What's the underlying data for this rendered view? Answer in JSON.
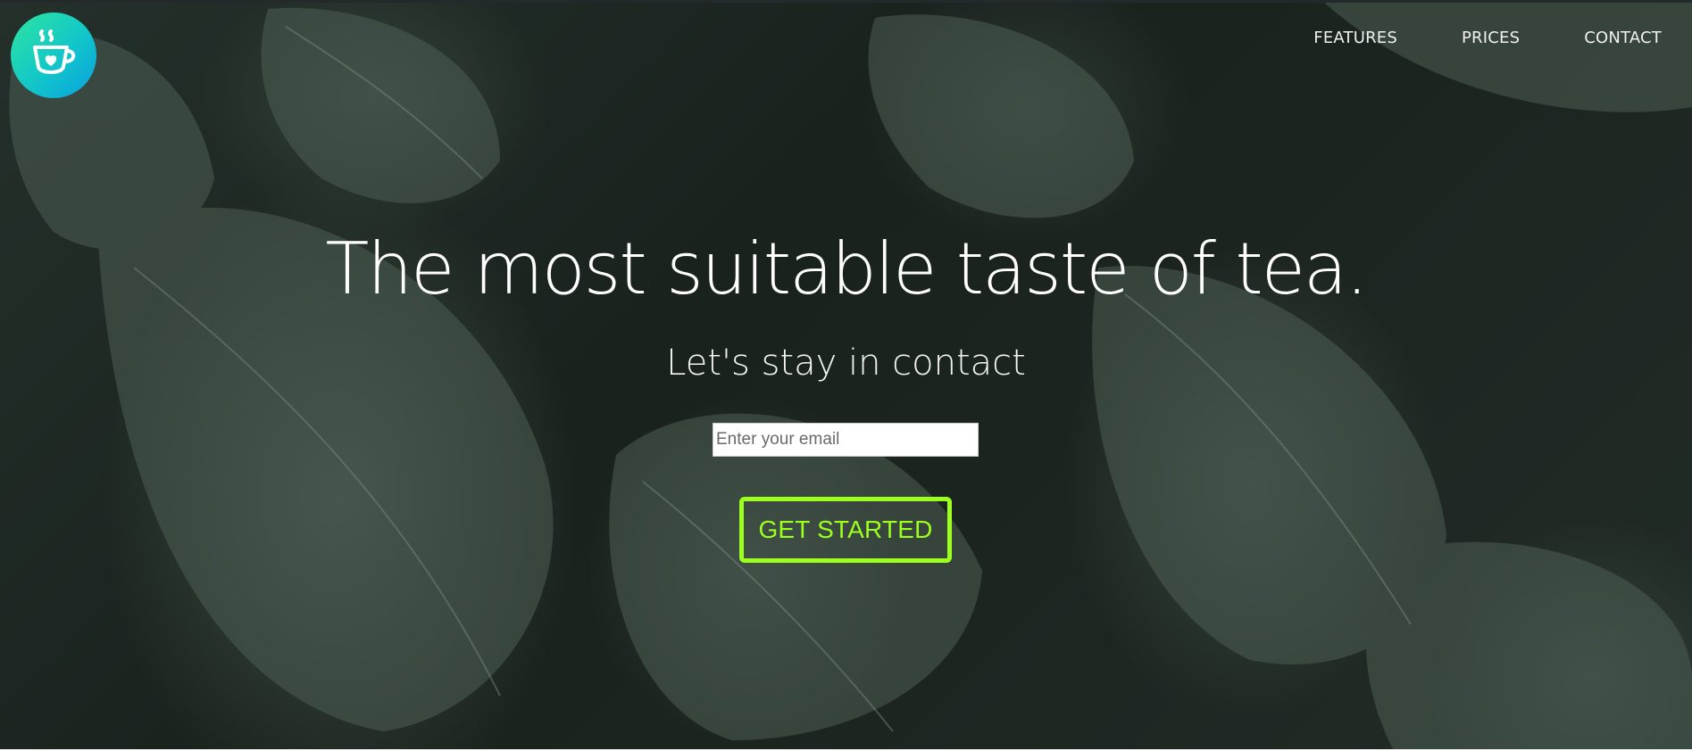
{
  "header": {
    "logo_icon": "tea-cup-heart-icon",
    "nav": [
      {
        "label": "FEATURES"
      },
      {
        "label": "PRICES"
      },
      {
        "label": "CONTACT"
      }
    ]
  },
  "hero": {
    "headline": "The most suitable taste of tea.",
    "subhead": "Let's stay in contact",
    "email": {
      "placeholder": "Enter your email",
      "value": ""
    },
    "cta_label": "GET STARTED",
    "background": "dark-green-leaves-photo"
  },
  "colors": {
    "accent": "#9cff1e",
    "logo_gradient_start": "#2ee6a0",
    "logo_gradient_end": "#0aa0e0",
    "background_dark": "#1c2420",
    "text": "#ffffff"
  }
}
